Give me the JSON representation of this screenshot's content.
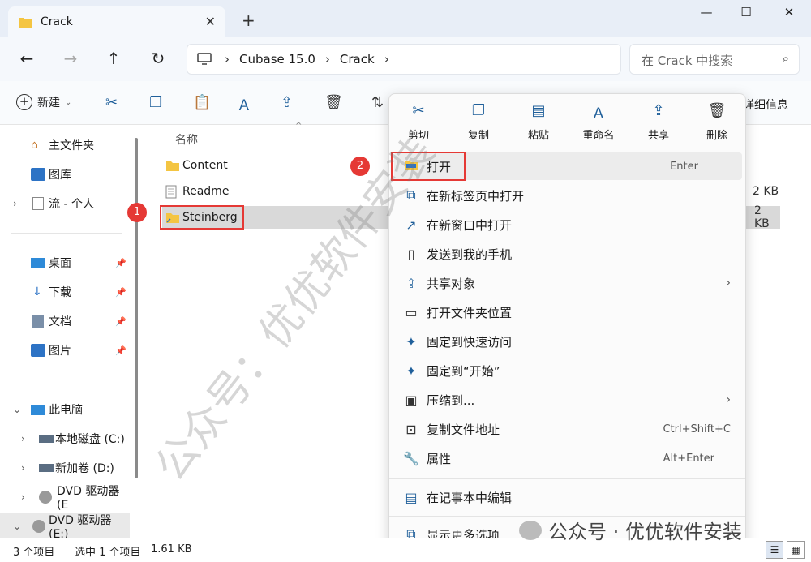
{
  "window": {
    "tab_title": "Crack",
    "tab_close": "✕",
    "new_tab": "+",
    "minimize": "—",
    "maximize": "☐",
    "close": "✕"
  },
  "nav": {
    "back": "←",
    "forward": "→",
    "up": "↑",
    "refresh": "↻",
    "breadcrumb": [
      "Cubase 15.0",
      "Crack"
    ],
    "search_placeholder": "在 Crack 中搜索"
  },
  "toolbar": {
    "new_label": "新建",
    "details_label": "详细信息"
  },
  "sidebar": {
    "items": [
      {
        "label": "主文件夹",
        "icon": "home-icon"
      },
      {
        "label": "图库",
        "icon": "gallery-icon"
      },
      {
        "label": "流 - 个人",
        "icon": "cloud-icon"
      },
      {
        "label": "桌面",
        "icon": "desktop-icon"
      },
      {
        "label": "下载",
        "icon": "download-icon"
      },
      {
        "label": "文档",
        "icon": "document-icon"
      },
      {
        "label": "图片",
        "icon": "pictures-icon"
      },
      {
        "label": "此电脑",
        "icon": "pc-icon"
      },
      {
        "label": "本地磁盘 (C:)",
        "icon": "drive-icon"
      },
      {
        "label": "新加卷 (D:)",
        "icon": "drive-icon"
      },
      {
        "label": "DVD 驱动器 (E",
        "icon": "dvd-icon"
      },
      {
        "label": "DVD 驱动器 (E:)",
        "icon": "dvd-icon"
      }
    ]
  },
  "content": {
    "column_name": "名称",
    "files": [
      {
        "name": "Content",
        "size": ""
      },
      {
        "name": "Readme",
        "size": "2 KB"
      },
      {
        "name": "Steinberg",
        "size": "2 KB"
      }
    ]
  },
  "badges": {
    "one": "1",
    "two": "2"
  },
  "context_menu": {
    "toolbar": [
      {
        "label": "剪切",
        "icon": "cut-icon"
      },
      {
        "label": "复制",
        "icon": "copy-icon"
      },
      {
        "label": "粘贴",
        "icon": "paste-icon"
      },
      {
        "label": "重命名",
        "icon": "rename-icon"
      },
      {
        "label": "共享",
        "icon": "share-icon"
      },
      {
        "label": "删除",
        "icon": "delete-icon"
      }
    ],
    "items": [
      {
        "label": "打开",
        "shortcut": "Enter"
      },
      {
        "label": "在新标签页中打开",
        "shortcut": ""
      },
      {
        "label": "在新窗口中打开",
        "shortcut": ""
      },
      {
        "label": "发送到我的手机",
        "shortcut": ""
      },
      {
        "label": "共享对象",
        "shortcut": ""
      },
      {
        "label": "打开文件夹位置",
        "shortcut": ""
      },
      {
        "label": "固定到快速访问",
        "shortcut": ""
      },
      {
        "label": "固定到“开始”",
        "shortcut": ""
      },
      {
        "label": "压缩到...",
        "shortcut": ""
      },
      {
        "label": "复制文件地址",
        "shortcut": "Ctrl+Shift+C"
      },
      {
        "label": "属性",
        "shortcut": "Alt+Enter"
      },
      {
        "label": "在记事本中编辑",
        "shortcut": ""
      },
      {
        "label": "显示更多选项",
        "shortcut": ""
      }
    ]
  },
  "status": {
    "count": "3 个项目",
    "selected": "选中 1 个项目",
    "size": "1.61 KB"
  },
  "watermark": {
    "diagonal": "公众号：优优软件安装",
    "footer": "公众号 · 优优软件安装"
  }
}
